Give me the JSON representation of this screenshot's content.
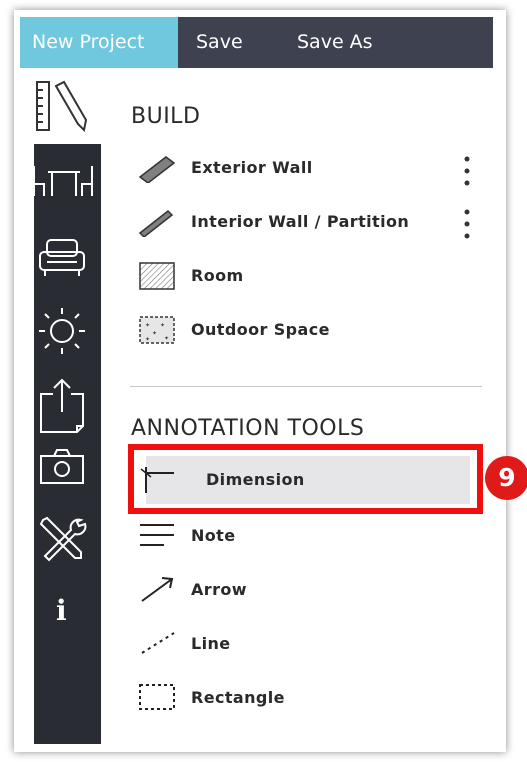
{
  "menubar": {
    "new_project": "New Project",
    "save": "Save",
    "save_as": "Save As"
  },
  "sidebar": {
    "icons": [
      "ruler-pencil-icon",
      "table-chairs-icon",
      "sofa-icon",
      "sun-icon",
      "export-icon",
      "camera-icon",
      "tools-icon",
      "info-icon"
    ],
    "info_glyph": "i"
  },
  "build": {
    "title": "BUILD",
    "items": [
      {
        "label": "Exterior Wall",
        "icon": "exterior-wall-icon"
      },
      {
        "label": "Interior Wall / Partition",
        "icon": "interior-wall-icon"
      },
      {
        "label": "Room",
        "icon": "room-icon"
      },
      {
        "label": "Outdoor Space",
        "icon": "outdoor-space-icon"
      }
    ]
  },
  "annotation": {
    "title": "ANNOTATION TOOLS",
    "items": [
      {
        "label": "Dimension",
        "icon": "dimension-icon"
      },
      {
        "label": "Note",
        "icon": "note-icon"
      },
      {
        "label": "Arrow",
        "icon": "arrow-icon"
      },
      {
        "label": "Line",
        "icon": "line-icon"
      },
      {
        "label": "Rectangle",
        "icon": "rectangle-icon"
      }
    ]
  },
  "callout": {
    "number": "9",
    "color": "#e01919"
  },
  "colors": {
    "menubar_bg": "#3d4150",
    "active_menu_bg": "#6fc8de",
    "sidebar_bg": "#2a2c33",
    "highlight_border": "#ef0f0f"
  }
}
